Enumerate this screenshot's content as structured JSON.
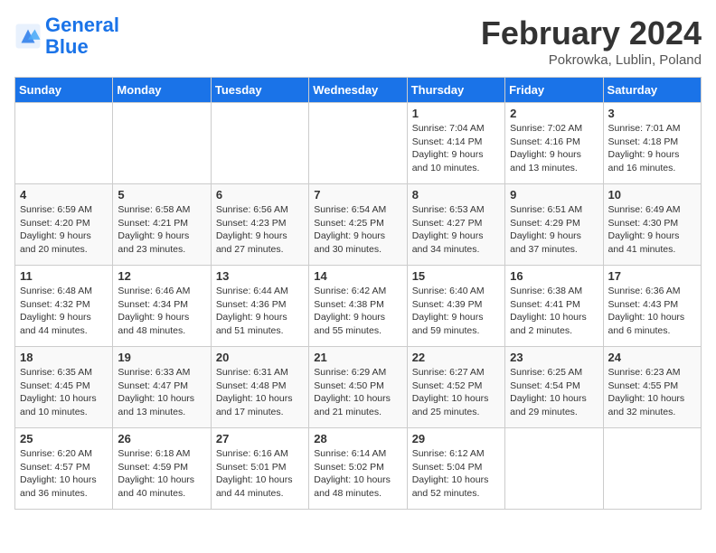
{
  "header": {
    "logo_line1": "General",
    "logo_line2": "Blue",
    "month_title": "February 2024",
    "subtitle": "Pokrowka, Lublin, Poland"
  },
  "days_of_week": [
    "Sunday",
    "Monday",
    "Tuesday",
    "Wednesday",
    "Thursday",
    "Friday",
    "Saturday"
  ],
  "weeks": [
    [
      {
        "day": "",
        "info": ""
      },
      {
        "day": "",
        "info": ""
      },
      {
        "day": "",
        "info": ""
      },
      {
        "day": "",
        "info": ""
      },
      {
        "day": "1",
        "info": "Sunrise: 7:04 AM\nSunset: 4:14 PM\nDaylight: 9 hours\nand 10 minutes."
      },
      {
        "day": "2",
        "info": "Sunrise: 7:02 AM\nSunset: 4:16 PM\nDaylight: 9 hours\nand 13 minutes."
      },
      {
        "day": "3",
        "info": "Sunrise: 7:01 AM\nSunset: 4:18 PM\nDaylight: 9 hours\nand 16 minutes."
      }
    ],
    [
      {
        "day": "4",
        "info": "Sunrise: 6:59 AM\nSunset: 4:20 PM\nDaylight: 9 hours\nand 20 minutes."
      },
      {
        "day": "5",
        "info": "Sunrise: 6:58 AM\nSunset: 4:21 PM\nDaylight: 9 hours\nand 23 minutes."
      },
      {
        "day": "6",
        "info": "Sunrise: 6:56 AM\nSunset: 4:23 PM\nDaylight: 9 hours\nand 27 minutes."
      },
      {
        "day": "7",
        "info": "Sunrise: 6:54 AM\nSunset: 4:25 PM\nDaylight: 9 hours\nand 30 minutes."
      },
      {
        "day": "8",
        "info": "Sunrise: 6:53 AM\nSunset: 4:27 PM\nDaylight: 9 hours\nand 34 minutes."
      },
      {
        "day": "9",
        "info": "Sunrise: 6:51 AM\nSunset: 4:29 PM\nDaylight: 9 hours\nand 37 minutes."
      },
      {
        "day": "10",
        "info": "Sunrise: 6:49 AM\nSunset: 4:30 PM\nDaylight: 9 hours\nand 41 minutes."
      }
    ],
    [
      {
        "day": "11",
        "info": "Sunrise: 6:48 AM\nSunset: 4:32 PM\nDaylight: 9 hours\nand 44 minutes."
      },
      {
        "day": "12",
        "info": "Sunrise: 6:46 AM\nSunset: 4:34 PM\nDaylight: 9 hours\nand 48 minutes."
      },
      {
        "day": "13",
        "info": "Sunrise: 6:44 AM\nSunset: 4:36 PM\nDaylight: 9 hours\nand 51 minutes."
      },
      {
        "day": "14",
        "info": "Sunrise: 6:42 AM\nSunset: 4:38 PM\nDaylight: 9 hours\nand 55 minutes."
      },
      {
        "day": "15",
        "info": "Sunrise: 6:40 AM\nSunset: 4:39 PM\nDaylight: 9 hours\nand 59 minutes."
      },
      {
        "day": "16",
        "info": "Sunrise: 6:38 AM\nSunset: 4:41 PM\nDaylight: 10 hours\nand 2 minutes."
      },
      {
        "day": "17",
        "info": "Sunrise: 6:36 AM\nSunset: 4:43 PM\nDaylight: 10 hours\nand 6 minutes."
      }
    ],
    [
      {
        "day": "18",
        "info": "Sunrise: 6:35 AM\nSunset: 4:45 PM\nDaylight: 10 hours\nand 10 minutes."
      },
      {
        "day": "19",
        "info": "Sunrise: 6:33 AM\nSunset: 4:47 PM\nDaylight: 10 hours\nand 13 minutes."
      },
      {
        "day": "20",
        "info": "Sunrise: 6:31 AM\nSunset: 4:48 PM\nDaylight: 10 hours\nand 17 minutes."
      },
      {
        "day": "21",
        "info": "Sunrise: 6:29 AM\nSunset: 4:50 PM\nDaylight: 10 hours\nand 21 minutes."
      },
      {
        "day": "22",
        "info": "Sunrise: 6:27 AM\nSunset: 4:52 PM\nDaylight: 10 hours\nand 25 minutes."
      },
      {
        "day": "23",
        "info": "Sunrise: 6:25 AM\nSunset: 4:54 PM\nDaylight: 10 hours\nand 29 minutes."
      },
      {
        "day": "24",
        "info": "Sunrise: 6:23 AM\nSunset: 4:55 PM\nDaylight: 10 hours\nand 32 minutes."
      }
    ],
    [
      {
        "day": "25",
        "info": "Sunrise: 6:20 AM\nSunset: 4:57 PM\nDaylight: 10 hours\nand 36 minutes."
      },
      {
        "day": "26",
        "info": "Sunrise: 6:18 AM\nSunset: 4:59 PM\nDaylight: 10 hours\nand 40 minutes."
      },
      {
        "day": "27",
        "info": "Sunrise: 6:16 AM\nSunset: 5:01 PM\nDaylight: 10 hours\nand 44 minutes."
      },
      {
        "day": "28",
        "info": "Sunrise: 6:14 AM\nSunset: 5:02 PM\nDaylight: 10 hours\nand 48 minutes."
      },
      {
        "day": "29",
        "info": "Sunrise: 6:12 AM\nSunset: 5:04 PM\nDaylight: 10 hours\nand 52 minutes."
      },
      {
        "day": "",
        "info": ""
      },
      {
        "day": "",
        "info": ""
      }
    ]
  ]
}
